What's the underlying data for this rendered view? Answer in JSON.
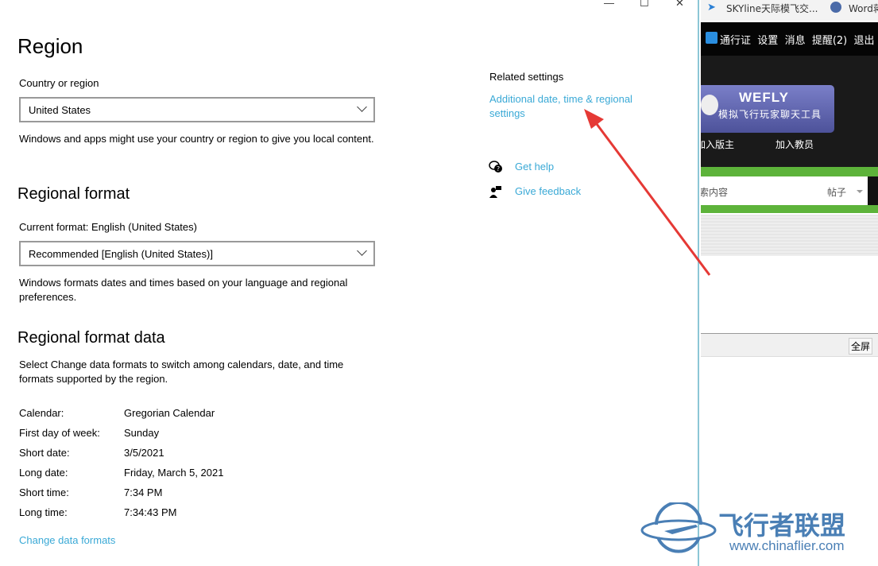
{
  "window_controls": {
    "minimize": "—",
    "maximize": "☐",
    "close": "✕"
  },
  "region": {
    "title": "Region",
    "country_label": "Country or region",
    "country_value": "United States",
    "country_desc": "Windows and apps might use your country or region to give you local content."
  },
  "regional_format": {
    "title": "Regional format",
    "current_label": "Current format: English (United States)",
    "value": "Recommended [English (United States)]",
    "desc": "Windows formats dates and times based on your language and regional preferences."
  },
  "format_data": {
    "title": "Regional format data",
    "desc": "Select Change data formats to switch among calendars, date, and time formats supported by the region.",
    "rows": [
      {
        "key": "Calendar:",
        "value": "Gregorian Calendar"
      },
      {
        "key": "First day of week:",
        "value": "Sunday"
      },
      {
        "key": "Short date:",
        "value": "3/5/2021"
      },
      {
        "key": "Long date:",
        "value": "Friday, March 5, 2021"
      },
      {
        "key": "Short time:",
        "value": "7:34 PM"
      },
      {
        "key": "Long time:",
        "value": "7:34:43 PM"
      }
    ],
    "change_link": "Change data formats"
  },
  "related": {
    "title": "Related settings",
    "link": "Additional date, time & regional settings",
    "get_help": "Get help",
    "give_feedback": "Give feedback"
  },
  "browser": {
    "tabs": [
      "SKYline天际模飞交...",
      "Word蒋"
    ],
    "nav": [
      "通行证",
      "设置",
      "消息",
      "提醒(2)",
      "退出"
    ],
    "banner_title": "WEFLY",
    "banner_sub": "模拟飞行玩家聊天工具",
    "links": [
      "加入版主",
      "加入教员"
    ],
    "search_placeholder": "索内容",
    "search_type": "帖子",
    "fullscreen": "全屏"
  },
  "watermark": {
    "cn": "飞行者联盟",
    "url": "www.chinaflier.com"
  },
  "colors": {
    "accent": "#3aa9d6",
    "arrow": "#e53935",
    "green": "#5db33a",
    "banner": "#5a5fa8"
  }
}
